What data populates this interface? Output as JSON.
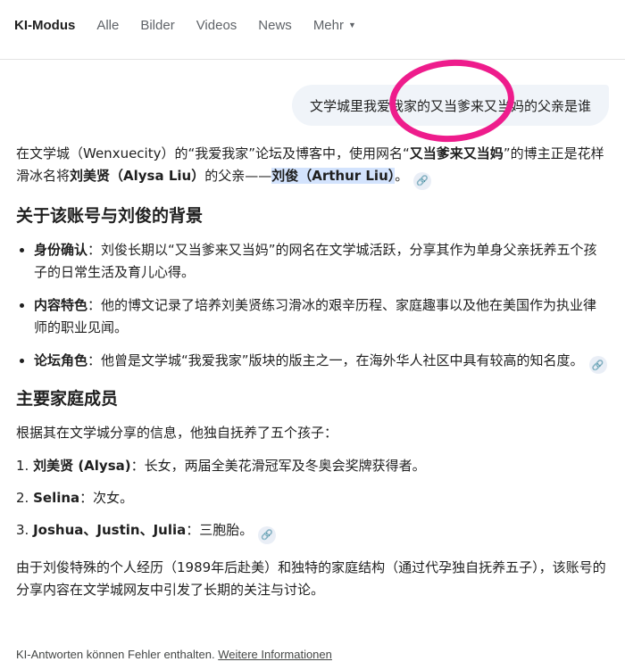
{
  "nav": {
    "tabs": [
      "KI-Modus",
      "Alle",
      "Bilder",
      "Videos",
      "News"
    ],
    "more_label": "Mehr"
  },
  "query": "文学城里我爱我家的又当爹来又当妈的父亲是谁",
  "intro": {
    "t1": "在文学城（Wenxuecity）的“我爱我家”论坛及博客中，使用网名“",
    "b1": "又当爹来又当妈",
    "t2": "”的博主正是花样滑冰名将",
    "b2": "刘美贤（Alysa Liu）",
    "t3": "的父亲——",
    "b3": "刘俊（Arthur Liu）",
    "t4": "。"
  },
  "section1": {
    "heading": "关于该账号与刘俊的背景",
    "items": [
      {
        "label": "身份确认",
        "text": "：刘俊长期以“又当爹来又当妈”的网名在文学城活跃，分享其作为单身父亲抚养五个孩子的日常生活及育儿心得。"
      },
      {
        "label": "内容特色",
        "text": "：他的博文记录了培养刘美贤练习滑冰的艰辛历程、家庭趣事以及他在美国作为执业律师的职业见闻。"
      },
      {
        "label": "论坛角色",
        "text": "：他曾是文学城“我爱我家”版块的版主之一，在海外华人社区中具有较高的知名度。"
      }
    ]
  },
  "section2": {
    "heading": "主要家庭成员",
    "intro": "根据其在文学城分享的信息，他独自抚养了五个孩子：",
    "items": [
      {
        "num": "1.",
        "label": "刘美贤 (Alysa)",
        "text": "：长女，两届全美花滑冠军及冬奥会奖牌获得者。"
      },
      {
        "num": "2.",
        "label": "Selina",
        "text": "：次女。"
      },
      {
        "num": "3.",
        "label": "Joshua、Justin、Julia",
        "text": "：三胞胎。"
      }
    ]
  },
  "outro": "由于刘俊特殊的个人经历（1989年后赴美）和独特的家庭结构（通过代孕独自抚养五子），该账号的分享内容在文学城网友中引发了长期的关注与讨论。",
  "footer": {
    "text": "KI-Antworten können Fehler enthalten.",
    "link": "Weitere Informationen"
  },
  "colors": {
    "highlight": "#d3e3fd",
    "annotation_circle": "#ee1c8c",
    "bubble_bg": "#f0f4f9"
  },
  "icons": {
    "link_chip": "link-icon",
    "more_caret": "caret-down-icon"
  }
}
